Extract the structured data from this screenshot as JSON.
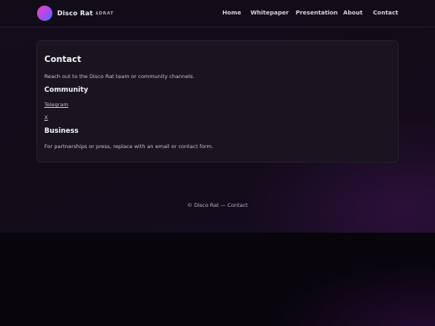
{
  "brand": {
    "name": "Disco Rat",
    "ticker": "$DRAT"
  },
  "nav": {
    "items": [
      {
        "label": "Home"
      },
      {
        "label": "Whitepaper"
      },
      {
        "label": "Presentation"
      },
      {
        "label": "About"
      },
      {
        "label": "Contact"
      }
    ]
  },
  "main": {
    "title": "Contact",
    "intro": "Reach out to the Disco Rat team or community channels.",
    "community": {
      "heading": "Community",
      "links": [
        {
          "label": "Telegram"
        },
        {
          "label": "X"
        }
      ]
    },
    "business": {
      "heading": "Business",
      "text": "For partnerships or press, replace with an email or contact form."
    }
  },
  "footer": {
    "text": "© Disco Rat — Contact"
  },
  "colors": {
    "background": "#120b18",
    "card": "#1a1420",
    "logo_gradient": [
      "#ff3cc8",
      "#a44cf0",
      "#3b7bff"
    ]
  }
}
